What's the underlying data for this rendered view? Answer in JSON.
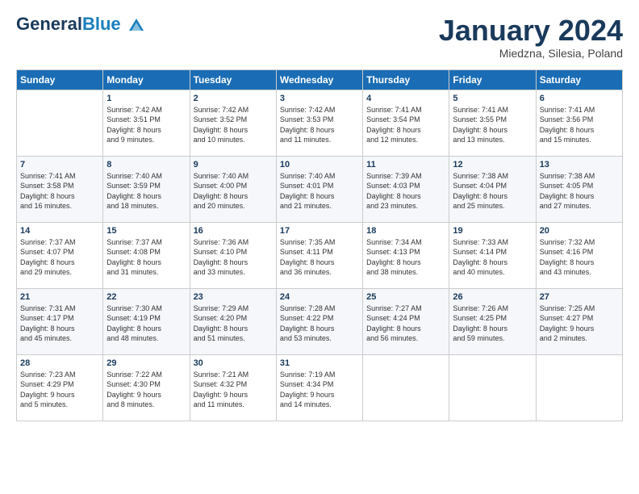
{
  "header": {
    "logo_general": "General",
    "logo_blue": "Blue",
    "month_title": "January 2024",
    "location": "Miedzna, Silesia, Poland"
  },
  "days_of_week": [
    "Sunday",
    "Monday",
    "Tuesday",
    "Wednesday",
    "Thursday",
    "Friday",
    "Saturday"
  ],
  "weeks": [
    [
      {
        "day": "",
        "content": ""
      },
      {
        "day": "1",
        "content": "Sunrise: 7:42 AM\nSunset: 3:51 PM\nDaylight: 8 hours\nand 9 minutes."
      },
      {
        "day": "2",
        "content": "Sunrise: 7:42 AM\nSunset: 3:52 PM\nDaylight: 8 hours\nand 10 minutes."
      },
      {
        "day": "3",
        "content": "Sunrise: 7:42 AM\nSunset: 3:53 PM\nDaylight: 8 hours\nand 11 minutes."
      },
      {
        "day": "4",
        "content": "Sunrise: 7:41 AM\nSunset: 3:54 PM\nDaylight: 8 hours\nand 12 minutes."
      },
      {
        "day": "5",
        "content": "Sunrise: 7:41 AM\nSunset: 3:55 PM\nDaylight: 8 hours\nand 13 minutes."
      },
      {
        "day": "6",
        "content": "Sunrise: 7:41 AM\nSunset: 3:56 PM\nDaylight: 8 hours\nand 15 minutes."
      }
    ],
    [
      {
        "day": "7",
        "content": "Sunrise: 7:41 AM\nSunset: 3:58 PM\nDaylight: 8 hours\nand 16 minutes."
      },
      {
        "day": "8",
        "content": "Sunrise: 7:40 AM\nSunset: 3:59 PM\nDaylight: 8 hours\nand 18 minutes."
      },
      {
        "day": "9",
        "content": "Sunrise: 7:40 AM\nSunset: 4:00 PM\nDaylight: 8 hours\nand 20 minutes."
      },
      {
        "day": "10",
        "content": "Sunrise: 7:40 AM\nSunset: 4:01 PM\nDaylight: 8 hours\nand 21 minutes."
      },
      {
        "day": "11",
        "content": "Sunrise: 7:39 AM\nSunset: 4:03 PM\nDaylight: 8 hours\nand 23 minutes."
      },
      {
        "day": "12",
        "content": "Sunrise: 7:38 AM\nSunset: 4:04 PM\nDaylight: 8 hours\nand 25 minutes."
      },
      {
        "day": "13",
        "content": "Sunrise: 7:38 AM\nSunset: 4:05 PM\nDaylight: 8 hours\nand 27 minutes."
      }
    ],
    [
      {
        "day": "14",
        "content": "Sunrise: 7:37 AM\nSunset: 4:07 PM\nDaylight: 8 hours\nand 29 minutes."
      },
      {
        "day": "15",
        "content": "Sunrise: 7:37 AM\nSunset: 4:08 PM\nDaylight: 8 hours\nand 31 minutes."
      },
      {
        "day": "16",
        "content": "Sunrise: 7:36 AM\nSunset: 4:10 PM\nDaylight: 8 hours\nand 33 minutes."
      },
      {
        "day": "17",
        "content": "Sunrise: 7:35 AM\nSunset: 4:11 PM\nDaylight: 8 hours\nand 36 minutes."
      },
      {
        "day": "18",
        "content": "Sunrise: 7:34 AM\nSunset: 4:13 PM\nDaylight: 8 hours\nand 38 minutes."
      },
      {
        "day": "19",
        "content": "Sunrise: 7:33 AM\nSunset: 4:14 PM\nDaylight: 8 hours\nand 40 minutes."
      },
      {
        "day": "20",
        "content": "Sunrise: 7:32 AM\nSunset: 4:16 PM\nDaylight: 8 hours\nand 43 minutes."
      }
    ],
    [
      {
        "day": "21",
        "content": "Sunrise: 7:31 AM\nSunset: 4:17 PM\nDaylight: 8 hours\nand 45 minutes."
      },
      {
        "day": "22",
        "content": "Sunrise: 7:30 AM\nSunset: 4:19 PM\nDaylight: 8 hours\nand 48 minutes."
      },
      {
        "day": "23",
        "content": "Sunrise: 7:29 AM\nSunset: 4:20 PM\nDaylight: 8 hours\nand 51 minutes."
      },
      {
        "day": "24",
        "content": "Sunrise: 7:28 AM\nSunset: 4:22 PM\nDaylight: 8 hours\nand 53 minutes."
      },
      {
        "day": "25",
        "content": "Sunrise: 7:27 AM\nSunset: 4:24 PM\nDaylight: 8 hours\nand 56 minutes."
      },
      {
        "day": "26",
        "content": "Sunrise: 7:26 AM\nSunset: 4:25 PM\nDaylight: 8 hours\nand 59 minutes."
      },
      {
        "day": "27",
        "content": "Sunrise: 7:25 AM\nSunset: 4:27 PM\nDaylight: 9 hours\nand 2 minutes."
      }
    ],
    [
      {
        "day": "28",
        "content": "Sunrise: 7:23 AM\nSunset: 4:29 PM\nDaylight: 9 hours\nand 5 minutes."
      },
      {
        "day": "29",
        "content": "Sunrise: 7:22 AM\nSunset: 4:30 PM\nDaylight: 9 hours\nand 8 minutes."
      },
      {
        "day": "30",
        "content": "Sunrise: 7:21 AM\nSunset: 4:32 PM\nDaylight: 9 hours\nand 11 minutes."
      },
      {
        "day": "31",
        "content": "Sunrise: 7:19 AM\nSunset: 4:34 PM\nDaylight: 9 hours\nand 14 minutes."
      },
      {
        "day": "",
        "content": ""
      },
      {
        "day": "",
        "content": ""
      },
      {
        "day": "",
        "content": ""
      }
    ]
  ]
}
